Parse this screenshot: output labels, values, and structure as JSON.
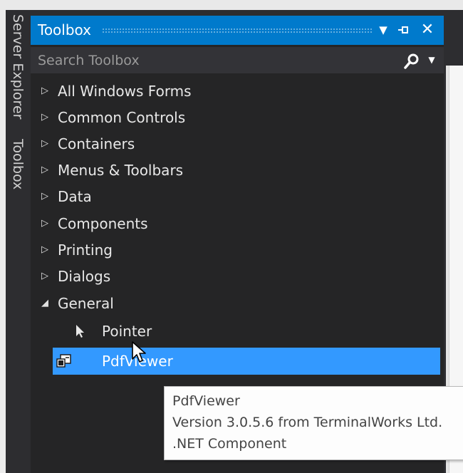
{
  "side_tabs": [
    "Server Explorer",
    "Toolbox"
  ],
  "toolbox": {
    "title": "Toolbox",
    "buttons": {
      "dropdown_icon": "dropdown-arrow-icon",
      "pin_icon": "pin-icon",
      "close_icon": "close-icon"
    },
    "search": {
      "placeholder": "Search Toolbox",
      "value": "",
      "icon": "search-icon"
    },
    "categories": [
      {
        "label": "All Windows Forms",
        "expanded": false
      },
      {
        "label": "Common Controls",
        "expanded": false
      },
      {
        "label": "Containers",
        "expanded": false
      },
      {
        "label": "Menus & Toolbars",
        "expanded": false
      },
      {
        "label": "Data",
        "expanded": false
      },
      {
        "label": "Components",
        "expanded": false
      },
      {
        "label": "Printing",
        "expanded": false
      },
      {
        "label": "Dialogs",
        "expanded": false
      },
      {
        "label": "General",
        "expanded": true
      }
    ],
    "general_items": [
      {
        "label": "Pointer",
        "icon": "pointer-arrow-icon",
        "selected": false
      },
      {
        "label": "PdfViewer",
        "icon": "component-icon",
        "selected": true
      }
    ]
  },
  "tooltip": {
    "lines": [
      "PdfViewer",
      "Version 3.0.5.6 from TerminalWorks Ltd.",
      ".NET Component"
    ]
  },
  "colors": {
    "accent": "#007acc",
    "selection": "#3399ff",
    "panel_bg": "#252526",
    "chrome_bg": "#2d2d30",
    "text": "#e8e8e8"
  }
}
